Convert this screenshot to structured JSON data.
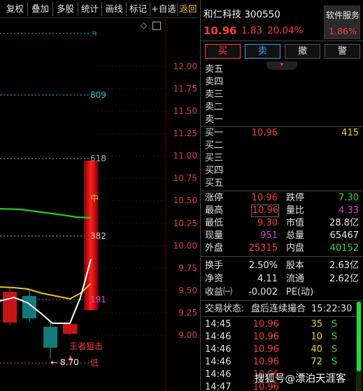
{
  "toolbar": {
    "buttons": [
      "复权",
      "叠加",
      "多股",
      "统计",
      "画线",
      "标记",
      "+自选",
      "返回"
    ]
  },
  "chart": {
    "price_axis": [
      "12.00",
      "11.75",
      "11.50",
      "11.25",
      "11.00",
      "10.75",
      "10.50",
      "10.25",
      "10.00",
      "9.75",
      "9.50",
      "9.25",
      "9.00"
    ],
    "fib_labels": {
      "top": "ㅋ",
      "f809": "809",
      "f618": "618",
      "mid": "中",
      "f382": "382",
      "f191": "191"
    },
    "annotations": {
      "wangzhe": "王者狙击",
      "low_price": "8.70",
      "low_arrow": "←",
      "low_tag": "低"
    },
    "colors": {
      "up": "#ff1a1a",
      "down": "#19b3b3",
      "ma_green": "#22cc22",
      "ma_yellow": "#e6c220",
      "ma_white": "#ffffff",
      "fib_cyan": "#19c8d8",
      "fib_gray": "#aaaaaa"
    }
  },
  "quote": {
    "name": "和仁科技",
    "code": "300550",
    "price": "10.96",
    "change": "1.83",
    "change_pct": "20.04%",
    "service_label": "软件服务",
    "service_pct": "1.86%"
  },
  "trade_buttons": [
    "买",
    "卖",
    "撤",
    "警"
  ],
  "asks": [
    {
      "label": "卖五",
      "price": "",
      "vol": ""
    },
    {
      "label": "卖四",
      "price": "",
      "vol": ""
    },
    {
      "label": "卖三",
      "price": "",
      "vol": ""
    },
    {
      "label": "卖二",
      "price": "",
      "vol": ""
    },
    {
      "label": "卖一",
      "price": "",
      "vol": ""
    }
  ],
  "bids": [
    {
      "label": "买一",
      "price": "10.96",
      "vol": "415"
    },
    {
      "label": "买二",
      "price": "",
      "vol": ""
    },
    {
      "label": "买三",
      "price": "",
      "vol": ""
    },
    {
      "label": "买四",
      "price": "",
      "vol": ""
    },
    {
      "label": "买五",
      "price": "",
      "vol": ""
    }
  ],
  "stats": {
    "zhangting_label": "涨停",
    "zhangting": "10.96",
    "dieting_label": "跌停",
    "dieting": "7.30",
    "zuigao_label": "最高",
    "zuigao": "10.96",
    "liangbi_label": "量比",
    "liangbi": "4.33",
    "zuidi_label": "最低",
    "zuidi": "9.30",
    "shizhi_label": "市值",
    "shizhi": "28.8亿",
    "xianliang_label": "现量",
    "xianliang": "951",
    "zongliang_label": "总量",
    "zongliang": "65467",
    "waipan_label": "外盘",
    "waipan": "25315",
    "neipan_label": "内盘",
    "neipan": "40152",
    "huanshou_label": "换手",
    "huanshou": "2.50%",
    "guben_label": "股本",
    "guben": "2.63亿",
    "jingzi_label": "净资",
    "jingzi": "4.11",
    "liutong_label": "流通",
    "liutong": "2.62亿",
    "shouyi_label": "收益㈠",
    "shouyi": "-0.002",
    "pe_label": "PE(动)",
    "pe": ""
  },
  "trade_status": {
    "label": "交易状态:",
    "status": "盘后连续撮合",
    "time": "15:22:30"
  },
  "ticks": [
    {
      "time": "14:45",
      "price": "10.96",
      "vol": "35",
      "side": "S"
    },
    {
      "time": "14:46",
      "price": "10.96",
      "vol": "10",
      "side": "S"
    },
    {
      "time": "14:46",
      "price": "10.96",
      "vol": "40",
      "side": "S"
    },
    {
      "time": "14:46",
      "price": "10.96",
      "vol": "72",
      "side": "S"
    },
    {
      "time": "14:46",
      "price": "10.96",
      "vol": "",
      "side": ""
    },
    {
      "time": "14:47",
      "price": "10.96",
      "vol": "",
      "side": ""
    }
  ],
  "watermark": "搜狐号@漂泊天涯客"
}
